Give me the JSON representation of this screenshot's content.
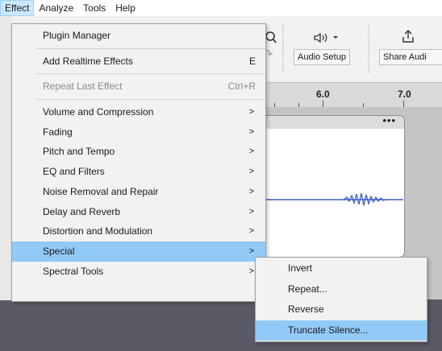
{
  "menubar": {
    "items": [
      "Effect",
      "Analyze",
      "Tools",
      "Help"
    ]
  },
  "toolbar": {
    "audio_setup_label": "Audio Setup",
    "share_audio_label": "Share Audi",
    "icons": [
      "zoom-icon",
      "speaker-icon",
      "share-icon"
    ]
  },
  "ruler": {
    "labels": [
      "6.0",
      "7.0"
    ]
  },
  "clip": {
    "menu_label": "•••"
  },
  "effect_menu": {
    "items": [
      {
        "label": "Plugin Manager",
        "shortcut": "",
        "submenu": false,
        "disabled": false
      },
      {
        "label": "Add Realtime Effects",
        "shortcut": "E",
        "submenu": false,
        "disabled": false
      },
      {
        "label": "Repeat Last Effect",
        "shortcut": "Ctrl+R",
        "submenu": false,
        "disabled": true
      },
      {
        "label": "Volume and Compression",
        "shortcut": "",
        "submenu": true,
        "disabled": false
      },
      {
        "label": "Fading",
        "shortcut": "",
        "submenu": true,
        "disabled": false
      },
      {
        "label": "Pitch and Tempo",
        "shortcut": "",
        "submenu": true,
        "disabled": false
      },
      {
        "label": "EQ and Filters",
        "shortcut": "",
        "submenu": true,
        "disabled": false
      },
      {
        "label": "Noise Removal and Repair",
        "shortcut": "",
        "submenu": true,
        "disabled": false
      },
      {
        "label": "Delay and Reverb",
        "shortcut": "",
        "submenu": true,
        "disabled": false
      },
      {
        "label": "Distortion and Modulation",
        "shortcut": "",
        "submenu": true,
        "disabled": false
      },
      {
        "label": "Special",
        "shortcut": "",
        "submenu": true,
        "disabled": false,
        "highlighted": true
      },
      {
        "label": "Spectral Tools",
        "shortcut": "",
        "submenu": true,
        "disabled": false
      }
    ]
  },
  "special_submenu": {
    "items": [
      {
        "label": "Invert"
      },
      {
        "label": "Repeat..."
      },
      {
        "label": "Reverse"
      },
      {
        "label": "Truncate Silence...",
        "highlighted": true
      }
    ]
  },
  "colors": {
    "highlight": "#91c9f7",
    "menu_bg": "#f2f2f2",
    "waveform": "#3b5fc7"
  }
}
